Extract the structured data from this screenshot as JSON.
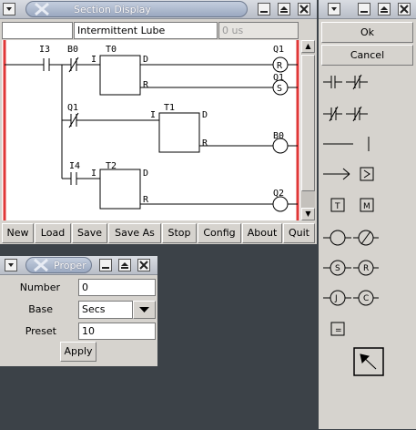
{
  "section_window": {
    "title": "Section Display",
    "fields": {
      "blank": "",
      "name": "Intermittent Lube",
      "time": "0 us"
    },
    "buttons": [
      "New",
      "Load",
      "Save",
      "Save As",
      "Stop",
      "Config",
      "About",
      "Quit"
    ],
    "ladder": {
      "labels": [
        "I3",
        "B0",
        "T0",
        "I",
        "D",
        "R",
        "Q1",
        "Q1",
        "Q1",
        "T1",
        "I",
        "D",
        "R",
        "B0",
        "I4",
        "T2",
        "I",
        "D",
        "R",
        "Q2"
      ],
      "coil_letters": [
        "R",
        "S"
      ]
    }
  },
  "palette_window": {
    "ok_label": "Ok",
    "cancel_label": "Cancel",
    "tool_letters": {
      "timer": "T",
      "memory": "M",
      "set": "S",
      "reset": "R",
      "jump": "J",
      "count": "C",
      "equals": "="
    }
  },
  "properties_window": {
    "title": "Proper",
    "number_label": "Number",
    "number_value": "0",
    "base_label": "Base",
    "base_value": "Secs",
    "preset_label": "Preset",
    "preset_value": "10",
    "apply_label": "Apply"
  },
  "colors": {
    "rail_red": "#e03838",
    "title_pill": "#aab6cc",
    "window_bg": "#d6d3ce",
    "desktop": "#3c4248"
  }
}
